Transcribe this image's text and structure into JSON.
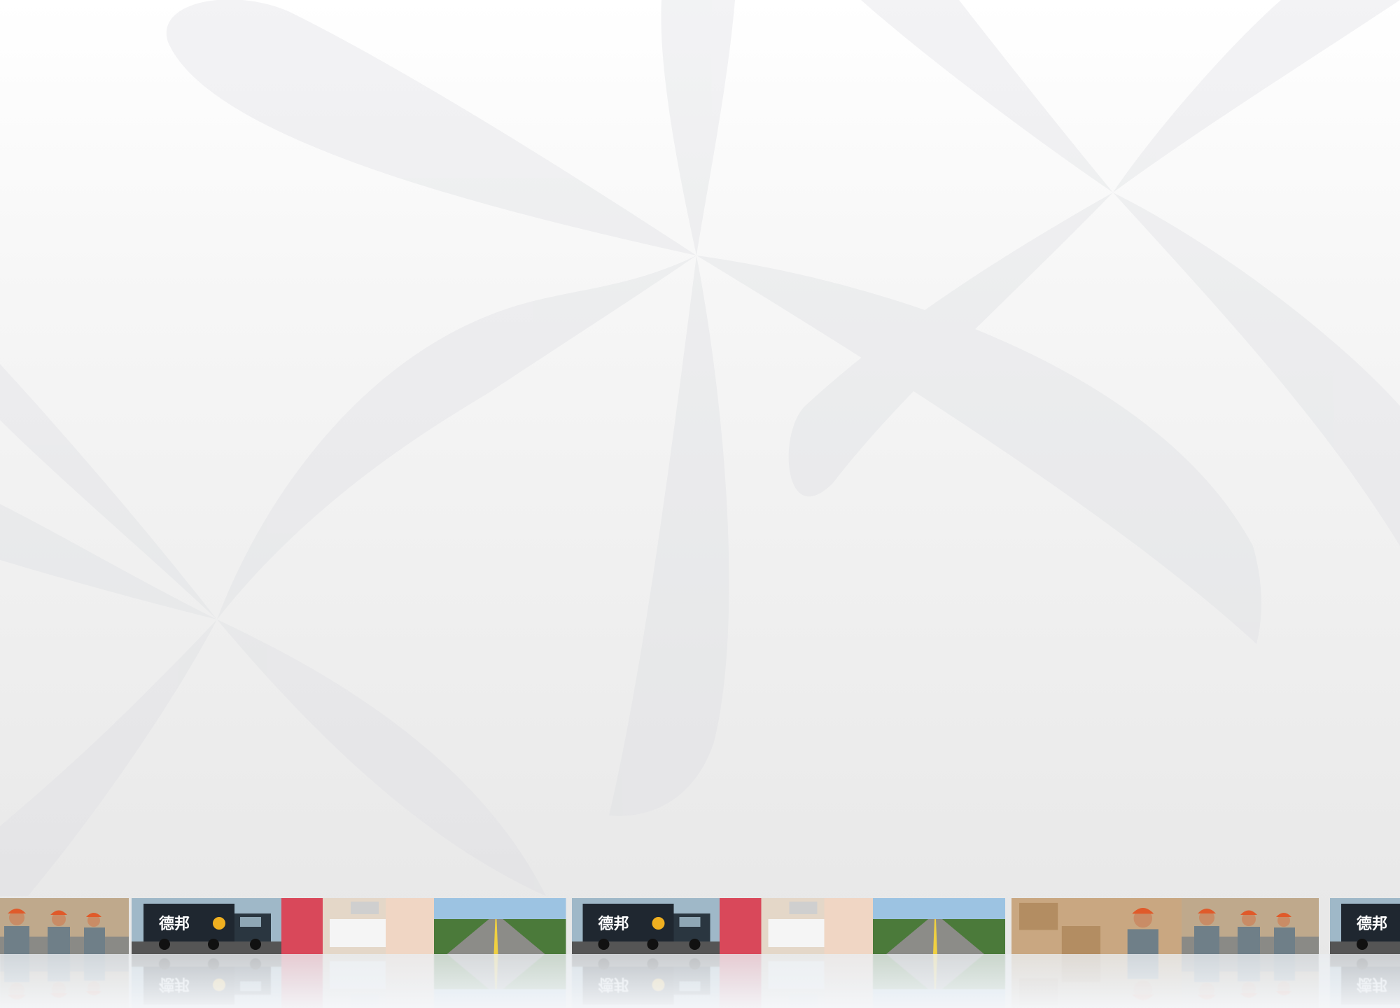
{
  "background": {
    "colors": {
      "top": "#ffffff",
      "bottom": "#e6e6e6",
      "petal": "#dcdee2"
    }
  },
  "photo_strip": {
    "tiles": [
      {
        "kind": "workers",
        "icon": "workers-photo"
      },
      {
        "kind": "truck",
        "icon": "truck-photo",
        "logo_text": "德邦"
      },
      {
        "kind": "office",
        "icon": "office-photo"
      },
      {
        "kind": "road",
        "icon": "road-photo"
      },
      {
        "kind": "truck",
        "icon": "truck-photo",
        "logo_text": "德邦"
      },
      {
        "kind": "office",
        "icon": "office-photo"
      },
      {
        "kind": "road",
        "icon": "road-photo"
      },
      {
        "kind": "boxes",
        "icon": "boxes-photo"
      },
      {
        "kind": "workers",
        "icon": "workers-photo"
      },
      {
        "kind": "truck",
        "icon": "truck-photo",
        "logo_text": "德邦"
      },
      {
        "kind": "office",
        "icon": "office-photo"
      }
    ]
  }
}
